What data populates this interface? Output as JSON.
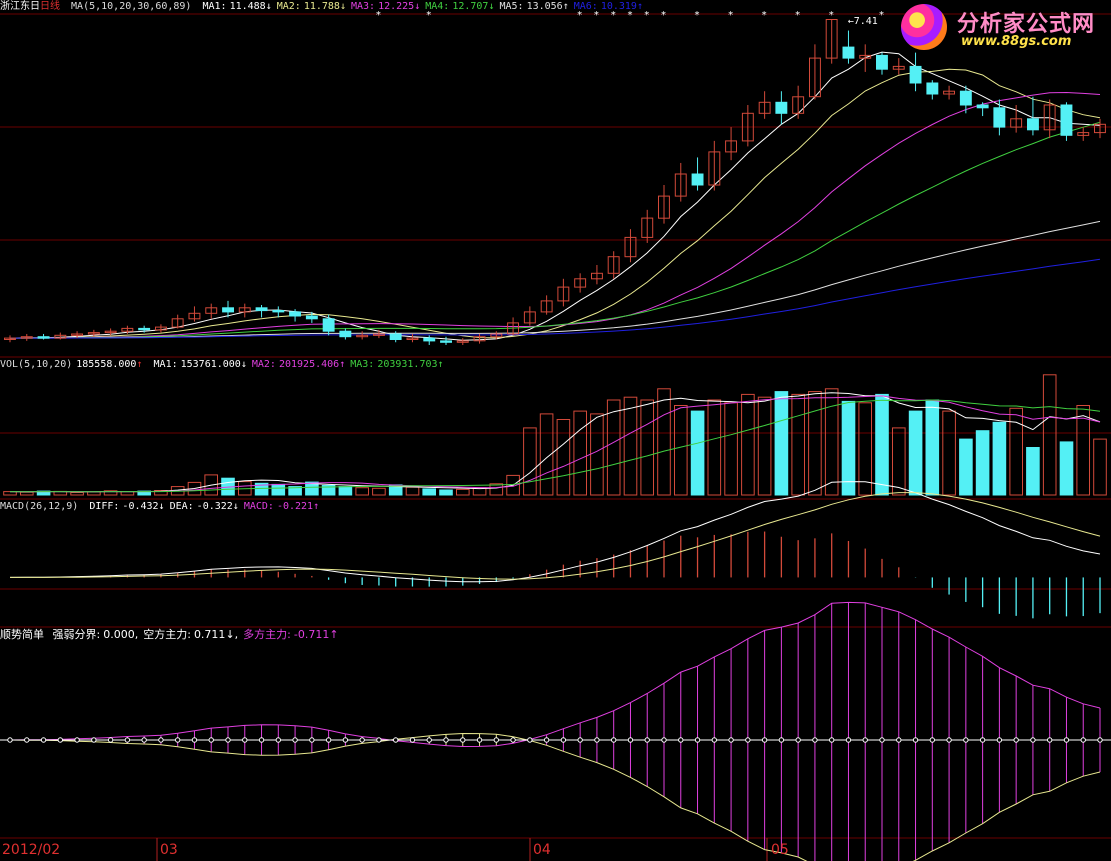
{
  "logo": {
    "title": "分析家公式网",
    "url": "www.88gs.com"
  },
  "colors": {
    "bg": "#000000",
    "grid": "#6a0000",
    "up": "#d34a3a",
    "down": "#54f0f5",
    "ma1": "#ffffff",
    "ma2": "#e8e890",
    "ma3": "#e040e0",
    "ma4": "#40d040",
    "ma5": "#e0e0e0",
    "ma6": "#2020e0",
    "bull": "#e8e890",
    "bear": "#e040e0"
  },
  "panels": {
    "price": {
      "name": "浙江东日",
      "period": "日线",
      "indicator": "MA(5,10,20,30,60,89)",
      "ma_values": [
        {
          "label": "MA1:",
          "value": "11.488",
          "arrow": "↓"
        },
        {
          "label": "MA2:",
          "value": "11.788",
          "arrow": "↓"
        },
        {
          "label": "MA3:",
          "value": "12.225",
          "arrow": "↓"
        },
        {
          "label": "MA4:",
          "value": "12.707",
          "arrow": "↓"
        },
        {
          "label": "MA5:",
          "value": "13.056",
          "arrow": "↑"
        },
        {
          "label": "MA6:",
          "value": "10.319",
          "arrow": "↑"
        }
      ],
      "high_marker": "7.41"
    },
    "volume": {
      "indicator": "VOL(5,10,20)",
      "value": "185558.000",
      "value_arrow": "↑",
      "ma_values": [
        {
          "label": "MA1:",
          "value": "153761.000",
          "arrow": "↓"
        },
        {
          "label": "MA2:",
          "value": "201925.406",
          "arrow": "↑"
        },
        {
          "label": "MA3:",
          "value": "203931.703",
          "arrow": "↑"
        }
      ]
    },
    "macd": {
      "indicator": "MACD(26,12,9)",
      "values": [
        {
          "label": "DIFF:",
          "value": "-0.432",
          "arrow": "↓"
        },
        {
          "label": "DEA:",
          "value": "-0.322",
          "arrow": "↓"
        },
        {
          "label": "MACD:",
          "value": "-0.221",
          "arrow": "↑"
        }
      ]
    },
    "trend": {
      "name": "顺势简单",
      "values": [
        {
          "label": "强弱分界:",
          "value": "0.000",
          "arrow": ","
        },
        {
          "label": "空方主力:",
          "value": "0.711",
          "arrow": "↓,"
        },
        {
          "label": "多方主力:",
          "value": "-0.711",
          "arrow": "↑"
        }
      ]
    }
  },
  "x_axis_labels": [
    "2012/02",
    "03",
    "04",
    "05"
  ],
  "chart_data": {
    "type": "candlestick",
    "x_labels": [
      "2012/02",
      "03",
      "04",
      "05"
    ],
    "candles_count": 66,
    "price_ylim": [
      5.6,
      17.6
    ],
    "high_marker": 17.41,
    "candles": [
      [
        5.8,
        5.85,
        5.7,
        5.95
      ],
      [
        5.85,
        5.9,
        5.75,
        6.0
      ],
      [
        5.9,
        5.85,
        5.8,
        6.0
      ],
      [
        5.85,
        5.95,
        5.8,
        6.05
      ],
      [
        5.95,
        6.0,
        5.85,
        6.1
      ],
      [
        6.0,
        6.05,
        5.9,
        6.15
      ],
      [
        6.05,
        6.1,
        5.95,
        6.2
      ],
      [
        6.1,
        6.2,
        6.0,
        6.3
      ],
      [
        6.2,
        6.15,
        6.05,
        6.3
      ],
      [
        6.15,
        6.25,
        6.05,
        6.35
      ],
      [
        6.25,
        6.55,
        6.2,
        6.7
      ],
      [
        6.55,
        6.75,
        6.45,
        7.0
      ],
      [
        6.75,
        6.95,
        6.55,
        7.1
      ],
      [
        6.95,
        6.8,
        6.6,
        7.2
      ],
      [
        6.8,
        6.95,
        6.6,
        7.1
      ],
      [
        6.95,
        6.85,
        6.6,
        7.05
      ],
      [
        6.85,
        6.8,
        6.6,
        7.0
      ],
      [
        6.8,
        6.65,
        6.45,
        6.9
      ],
      [
        6.65,
        6.55,
        6.4,
        6.8
      ],
      [
        6.55,
        6.1,
        5.95,
        6.7
      ],
      [
        6.1,
        5.9,
        5.8,
        6.2
      ],
      [
        5.9,
        5.95,
        5.8,
        6.1
      ],
      [
        5.95,
        6.0,
        5.85,
        6.15
      ],
      [
        6.0,
        5.8,
        5.7,
        6.1
      ],
      [
        5.8,
        5.85,
        5.7,
        6.0
      ],
      [
        5.85,
        5.75,
        5.6,
        5.95
      ],
      [
        5.75,
        5.7,
        5.6,
        5.9
      ],
      [
        5.7,
        5.75,
        5.6,
        5.85
      ],
      [
        5.75,
        5.9,
        5.65,
        6.0
      ],
      [
        5.9,
        6.0,
        5.8,
        6.1
      ],
      [
        6.0,
        6.4,
        5.95,
        6.6
      ],
      [
        6.4,
        6.8,
        6.3,
        7.0
      ],
      [
        6.8,
        7.2,
        6.7,
        7.4
      ],
      [
        7.2,
        7.7,
        7.0,
        8.0
      ],
      [
        7.7,
        8.0,
        7.5,
        8.2
      ],
      [
        8.0,
        8.2,
        7.8,
        8.5
      ],
      [
        8.2,
        8.8,
        8.0,
        9.0
      ],
      [
        8.8,
        9.5,
        8.6,
        9.8
      ],
      [
        9.5,
        10.2,
        9.3,
        10.5
      ],
      [
        10.2,
        11.0,
        10.0,
        11.4
      ],
      [
        11.0,
        11.8,
        10.8,
        12.2
      ],
      [
        11.8,
        11.4,
        11.2,
        12.4
      ],
      [
        11.4,
        12.6,
        11.2,
        13.0
      ],
      [
        12.6,
        13.0,
        12.3,
        13.5
      ],
      [
        13.0,
        14.0,
        12.8,
        14.3
      ],
      [
        14.0,
        14.4,
        13.8,
        14.8
      ],
      [
        14.4,
        14.0,
        13.6,
        14.8
      ],
      [
        14.0,
        14.6,
        13.8,
        15.0
      ],
      [
        14.6,
        16.0,
        14.5,
        16.5
      ],
      [
        16.0,
        17.4,
        15.8,
        17.41
      ],
      [
        16.4,
        16.0,
        15.8,
        17.0
      ],
      [
        16.0,
        16.1,
        15.5,
        16.5
      ],
      [
        16.1,
        15.6,
        15.4,
        16.2
      ],
      [
        15.6,
        15.7,
        15.4,
        16.0
      ],
      [
        15.7,
        15.1,
        14.8,
        16.2
      ],
      [
        15.1,
        14.7,
        14.5,
        15.2
      ],
      [
        14.7,
        14.8,
        14.5,
        15.0
      ],
      [
        14.8,
        14.3,
        14.0,
        15.0
      ],
      [
        14.3,
        14.2,
        13.9,
        14.4
      ],
      [
        14.2,
        13.5,
        13.2,
        14.5
      ],
      [
        13.5,
        13.8,
        13.3,
        14.3
      ],
      [
        13.8,
        13.4,
        13.2,
        14.6
      ],
      [
        13.4,
        14.3,
        13.1,
        14.5
      ],
      [
        14.3,
        13.2,
        13.0,
        14.4
      ],
      [
        13.2,
        13.3,
        13.0,
        13.5
      ],
      [
        13.3,
        13.6,
        13.1,
        13.8
      ]
    ],
    "volume_ylim": [
      0,
      440000
    ],
    "volume": [
      12000,
      10000,
      14000,
      13000,
      9000,
      11000,
      15000,
      12000,
      14000,
      16000,
      30000,
      45000,
      72000,
      60000,
      48000,
      42000,
      38000,
      30000,
      46000,
      34000,
      30000,
      26000,
      24000,
      36000,
      28000,
      22000,
      18000,
      20000,
      26000,
      40000,
      70000,
      240000,
      290000,
      270000,
      300000,
      290000,
      340000,
      350000,
      340000,
      380000,
      320000,
      300000,
      340000,
      330000,
      360000,
      350000,
      370000,
      360000,
      370000,
      380000,
      335000,
      330000,
      360000,
      240000,
      300000,
      340000,
      300000,
      200000,
      230000,
      260000,
      310000,
      170000,
      430000,
      190000,
      320000,
      200000
    ],
    "macd_ylim": [
      -1.2,
      1.6
    ],
    "trend_ylim": [
      -1.9,
      1.9
    ],
    "ma_periods": [
      5,
      10,
      20,
      30,
      60,
      89
    ],
    "volume_ma_periods": [
      5,
      10,
      20
    ],
    "macd_params": [
      26,
      12,
      9
    ]
  }
}
